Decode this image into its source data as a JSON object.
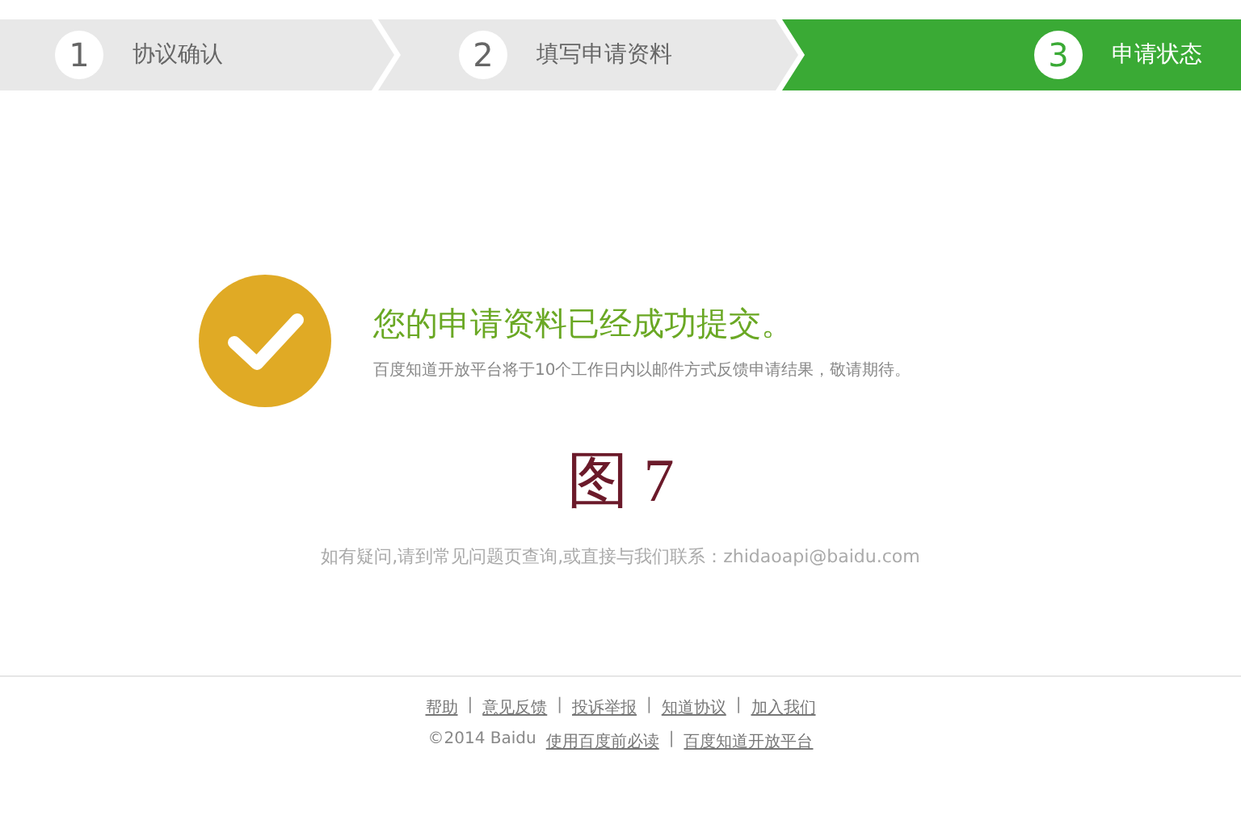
{
  "steps": [
    {
      "number": "1",
      "label": "协议确认",
      "selected": false
    },
    {
      "number": "2",
      "label": "填写申请资料",
      "selected": false
    },
    {
      "number": "3",
      "label": "申请状态",
      "selected": true
    }
  ],
  "result": {
    "title": "您的申请资料已经成功提交。",
    "message": "百度知道开放平台将于10个工作日内以邮件方式反馈申请结果，敬请期待。"
  },
  "caption": "图 7",
  "contact": "如有疑问,请到常见问题页查询,或直接与我们联系：zhidaoapi@baidu.com",
  "footer": {
    "separator": "|",
    "links": [
      "帮助",
      "意见反馈",
      "投诉举报",
      "知道协议",
      "加入我们"
    ],
    "copyright": "©2014 Baidu",
    "bottom_links": [
      "使用百度前必读",
      "百度知道开放平台"
    ]
  }
}
